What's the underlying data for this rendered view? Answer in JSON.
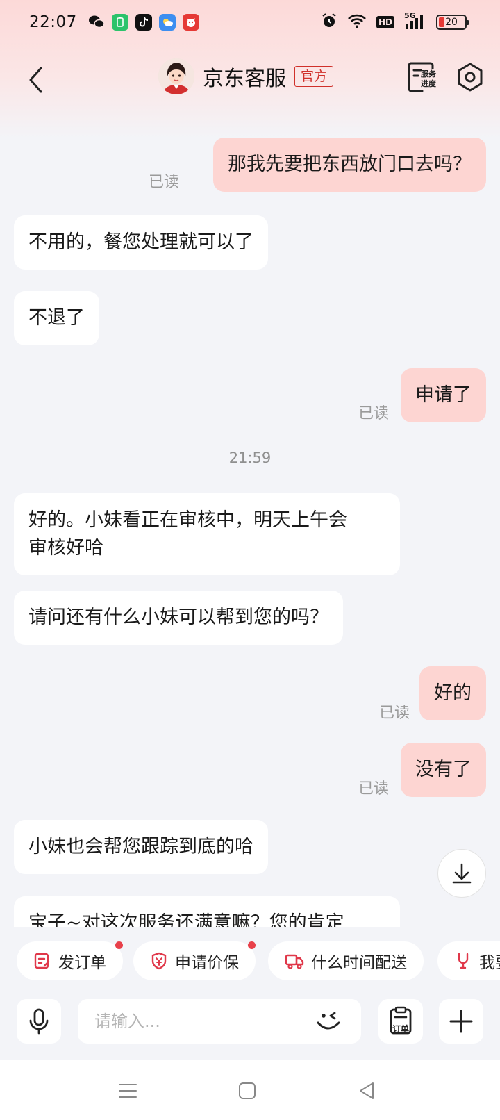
{
  "status_bar": {
    "time": "22:07",
    "network": "5G",
    "hd_label": "HD",
    "battery": "20",
    "battery_level": 0.2
  },
  "header": {
    "title": "京东客服",
    "official_badge": "官方",
    "service_progress_line1": "服务",
    "service_progress_line2": "进度"
  },
  "messages": [
    {
      "direction": "out",
      "text": "那我先要把东西放门口去吗？",
      "read_label": "已读"
    },
    {
      "direction": "in",
      "text": "不用的，餐您处理就可以了"
    },
    {
      "direction": "in",
      "text": "不退了"
    },
    {
      "direction": "out",
      "text": "申请了",
      "read_label": "已读"
    },
    {
      "type": "timestamp",
      "text": "21:59"
    },
    {
      "direction": "in",
      "line1": "好的。小妹看正在审核中，明天上午会",
      "line2": "审核好哈"
    },
    {
      "direction": "in",
      "text": "请问还有什么小妹可以帮到您的吗？"
    },
    {
      "direction": "out",
      "text": "好的",
      "read_label": "已读"
    },
    {
      "direction": "out",
      "text": "没有了",
      "read_label": "已读"
    },
    {
      "direction": "in",
      "text": "小妹也会帮您跟踪到底的哈"
    },
    {
      "direction": "in",
      "text": "宝子~对这次服务还满意嘛？您的肯定"
    }
  ],
  "quick_actions": [
    {
      "label": "发订单",
      "has_dot": true
    },
    {
      "label": "申请价保",
      "has_dot": true
    },
    {
      "label": "什么时间配送",
      "has_dot": false
    },
    {
      "label": "我要",
      "has_dot": false
    }
  ],
  "input": {
    "placeholder": "请输入...",
    "value": "",
    "order_label": "订单"
  },
  "colors": {
    "accent": "#d0302a",
    "outgoing_bubble": "#fdd5d2",
    "incoming_bubble": "#ffffff",
    "background": "#f3f4f8",
    "notification_dot": "#e8404a"
  },
  "icons": [
    "back-icon",
    "service-progress-icon",
    "settings-icon",
    "scroll-down-icon",
    "order-icon",
    "price-protect-icon",
    "truck-icon",
    "wrench-icon",
    "mic-icon",
    "emoji-icon",
    "order-button-icon",
    "plus-icon",
    "nav-menu-icon",
    "nav-home-icon",
    "nav-back-icon"
  ]
}
